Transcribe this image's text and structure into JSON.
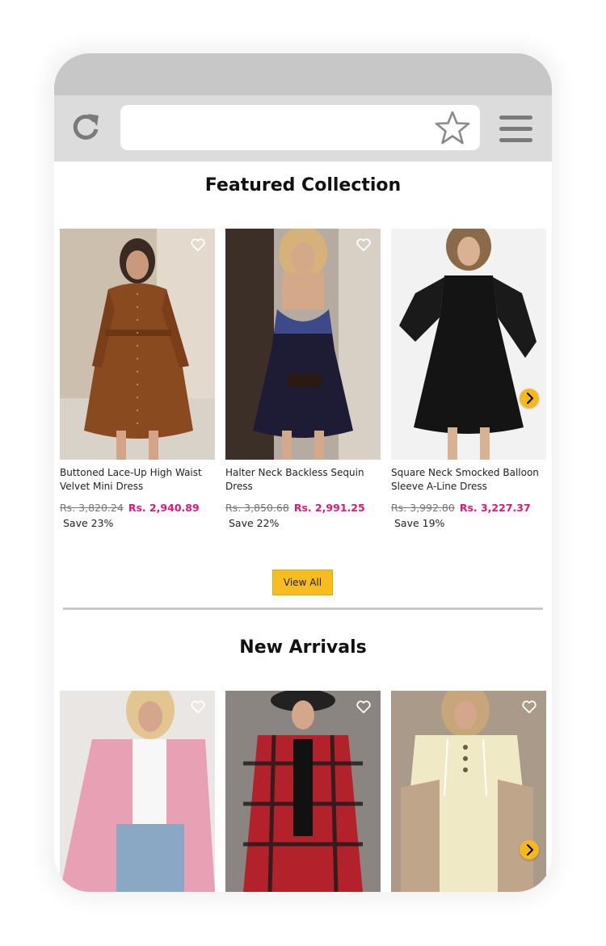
{
  "browser": {
    "reload_icon": "reload-icon",
    "bookmark_icon": "star-icon",
    "menu_icon": "hamburger-menu-icon"
  },
  "featured": {
    "title": "Featured Collection",
    "view_all_label": "View All",
    "products": [
      {
        "name": "Buttoned Lace-Up High Waist Velvet Mini Dress",
        "old_price": "Rs. 3,820.24",
        "new_price": "Rs. 2,940.89",
        "save": "Save 23%"
      },
      {
        "name": "Halter Neck Backless Sequin Dress",
        "old_price": "Rs. 3,850.68",
        "new_price": "Rs. 2,991.25",
        "save": "Save 22%"
      },
      {
        "name": "Square Neck Smocked Balloon Sleeve A-Line Dress",
        "old_price": "Rs. 3,992.80",
        "new_price": "Rs. 3,227.37",
        "save": "Save 19%"
      }
    ]
  },
  "new_arrivals": {
    "title": "New Arrivals"
  },
  "colors": {
    "accent": "#f5b91d",
    "sale_price": "#e0157a"
  }
}
